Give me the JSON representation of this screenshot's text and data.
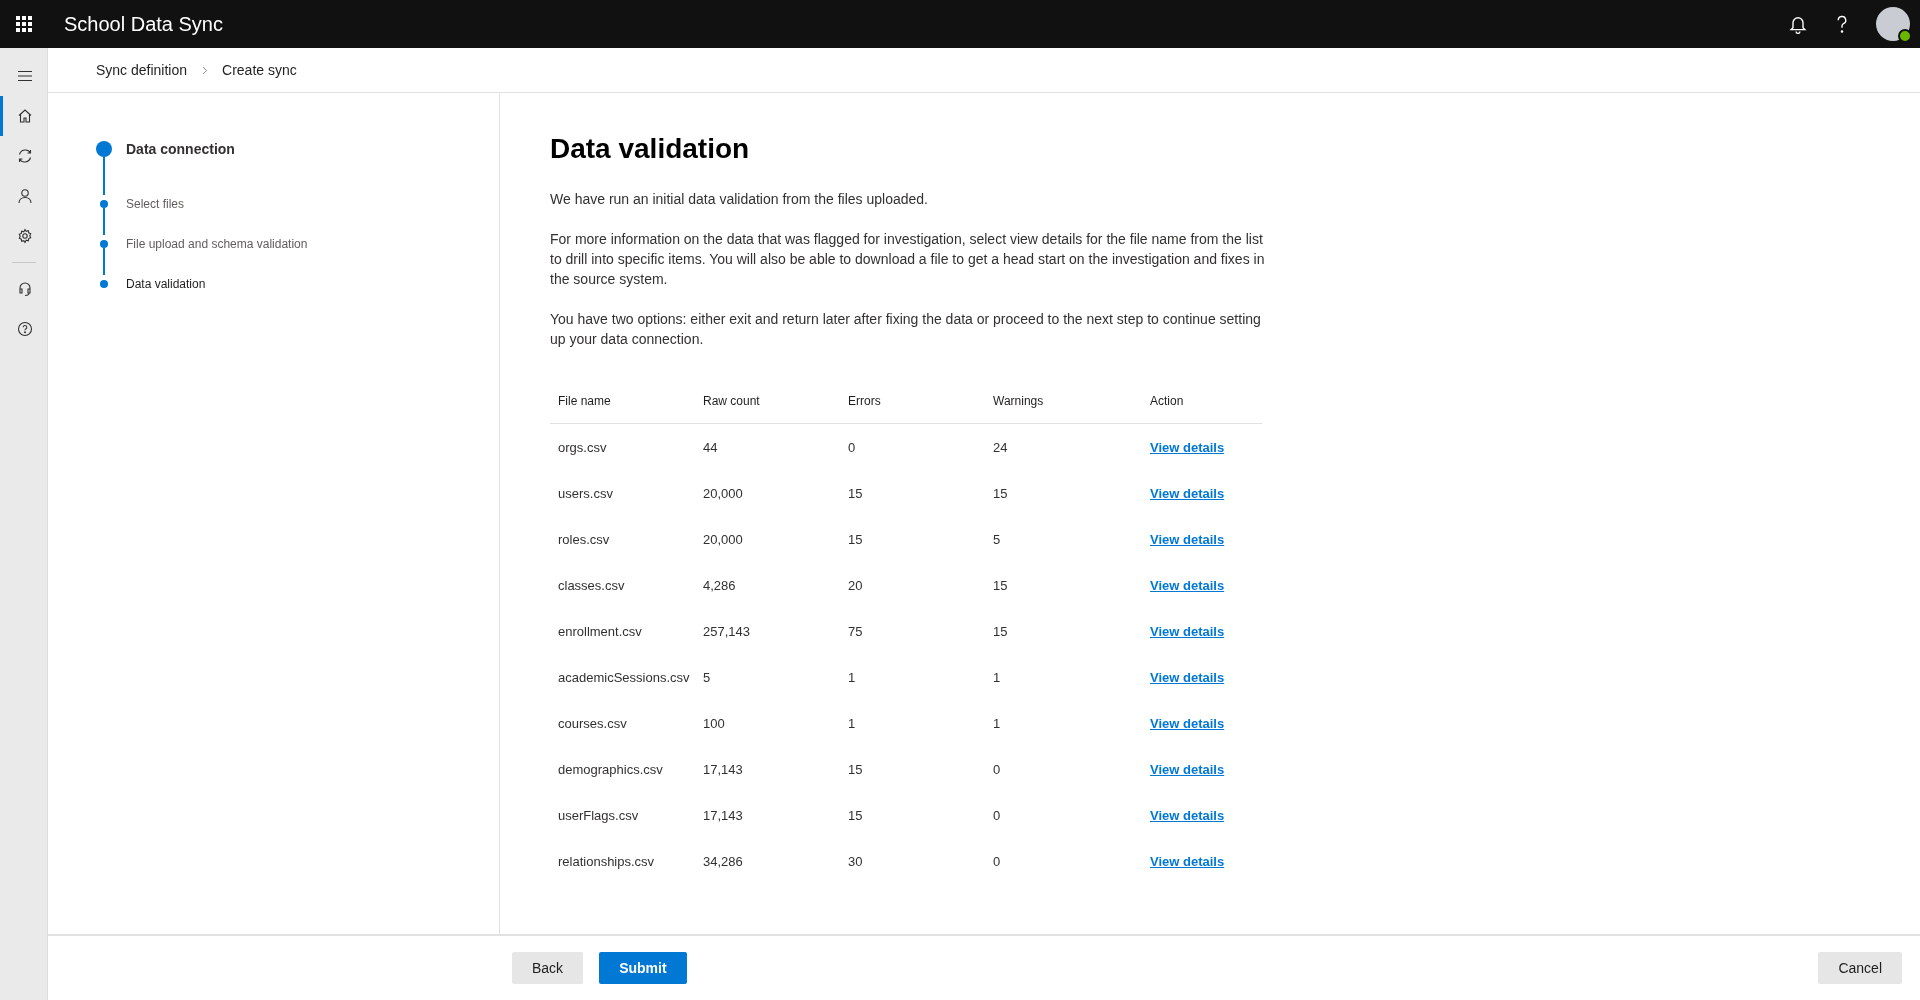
{
  "app_bar": {
    "title": "School Data Sync"
  },
  "nav_rail": [
    {
      "selected": false
    },
    {
      "selected": true
    },
    {
      "selected": false
    },
    {
      "selected": false
    },
    {
      "selected": false
    },
    {
      "selected": false
    },
    {
      "selected": false
    }
  ],
  "breadcrumb": [
    "Sync definition",
    "Create sync"
  ],
  "stepper": {
    "title": "Data connection",
    "steps": [
      {
        "label": "Select files",
        "selected": false
      },
      {
        "label": "File upload and schema validation",
        "selected": false
      },
      {
        "label": "Data validation",
        "selected": true
      }
    ]
  },
  "page": {
    "title": "Data validation",
    "paragraphs": [
      "We have run an initial data validation from the files uploaded.",
      "For more information on the data that was flagged for investigation, select view details for the file name from the list to drill into specific items. You will also be able to download a file to get a head start on the investigation and fixes in the source system.",
      "You have two options: either exit and return later after fixing the data or proceed to the next step to continue setting up your data connection."
    ]
  },
  "table": {
    "columns": [
      "File name",
      "Raw count",
      "Errors",
      "Warnings",
      "Action"
    ],
    "rows": [
      {
        "file": "orgs.csv",
        "raw_count": "44",
        "errors": "0",
        "warnings": "24",
        "action": "View details"
      },
      {
        "file": "users.csv",
        "raw_count": "20,000",
        "errors": "15",
        "warnings": "15",
        "action": "View details"
      },
      {
        "file": "roles.csv",
        "raw_count": "20,000",
        "errors": "15",
        "warnings": "5",
        "action": "View details"
      },
      {
        "file": "classes.csv",
        "raw_count": "4,286",
        "errors": "20",
        "warnings": "15",
        "action": "View details"
      },
      {
        "file": "enrollment.csv",
        "raw_count": "257,143",
        "errors": "75",
        "warnings": "15",
        "action": "View details"
      },
      {
        "file": "academicSessions.csv",
        "raw_count": "5",
        "errors": "1",
        "warnings": "1",
        "action": "View details"
      },
      {
        "file": "courses.csv",
        "raw_count": "100",
        "errors": "1",
        "warnings": "1",
        "action": "View details"
      },
      {
        "file": "demographics.csv",
        "raw_count": "17,143",
        "errors": "15",
        "warnings": "0",
        "action": "View details"
      },
      {
        "file": "userFlags.csv",
        "raw_count": "17,143",
        "errors": "15",
        "warnings": "0",
        "action": "View details"
      },
      {
        "file": "relationships.csv",
        "raw_count": "34,286",
        "errors": "30",
        "warnings": "0",
        "action": "View details"
      }
    ]
  },
  "footer": {
    "buttons": [
      {
        "label": "Back",
        "kind": "secondary"
      },
      {
        "label": "Submit",
        "kind": "primary"
      },
      {
        "label": "Cancel",
        "kind": "secondary"
      }
    ]
  }
}
